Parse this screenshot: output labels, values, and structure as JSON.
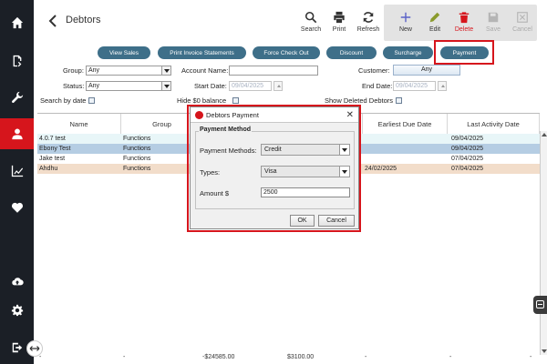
{
  "header": {
    "title": "Debtors",
    "tools": [
      {
        "label": "Search"
      },
      {
        "label": "Print"
      },
      {
        "label": "Refresh"
      },
      {
        "label": "New"
      },
      {
        "label": "Edit"
      },
      {
        "label": "Delete"
      },
      {
        "label": "Save"
      },
      {
        "label": "Cancel"
      }
    ]
  },
  "actions": [
    "View Sales",
    "Print Invoice Statements",
    "Force Check Out",
    "Discount",
    "Surcharge",
    "Payment"
  ],
  "filters": {
    "group_label": "Group:",
    "group_value": "Any",
    "account_name_label": "Account Name:",
    "account_name_value": "",
    "customer_label": "Customer:",
    "customer_value": "Any",
    "status_label": "Status:",
    "status_value": "Any",
    "start_date_label": "Start Date:",
    "start_date_value": "09/04/2025",
    "end_date_label": "End Date:",
    "end_date_value": "09/04/2025",
    "search_by_date_label": "Search by date",
    "hide_zero_label": "Hide $0 balance",
    "show_deleted_label": "Show Deleted Debtors"
  },
  "table": {
    "columns": [
      "Name",
      "Group",
      "Earliest Due Date",
      "Last Activity Date"
    ],
    "rows": [
      {
        "name": "4.0.7 test",
        "group": "Functions",
        "due": "",
        "activity": "09/04/2025"
      },
      {
        "name": "Ebony Test",
        "group": "Functions",
        "due": "",
        "activity": "09/04/2025"
      },
      {
        "name": "Jake test",
        "group": "Functions",
        "due": "",
        "activity": "07/04/2025"
      },
      {
        "name": "Ahdhu",
        "group": "Functions",
        "due": "24/02/2025",
        "activity": "07/04/2025"
      }
    ],
    "footer": {
      "c1": "-",
      "c2": "-",
      "c3": "-$24585.00",
      "c4": "$3100.00",
      "c5": "-",
      "c6": "-",
      "c7": "-"
    }
  },
  "dialog": {
    "title": "Debtors Payment",
    "group_title": "Payment Method",
    "methods_label": "Payment Methods:",
    "methods_value": "Credit",
    "types_label": "Types:",
    "types_value": "Visa",
    "amount_label": "Amount $",
    "amount_value": "2500",
    "ok_label": "OK",
    "cancel_label": "Cancel"
  },
  "colors": {
    "sidebar": "#1b1f26",
    "accent_red": "#d6151c",
    "pill_blue": "#3e6f89",
    "row_cyan": "#e8f6f8",
    "row_selected": "#b5cde3",
    "row_peach": "#f2ddca"
  }
}
